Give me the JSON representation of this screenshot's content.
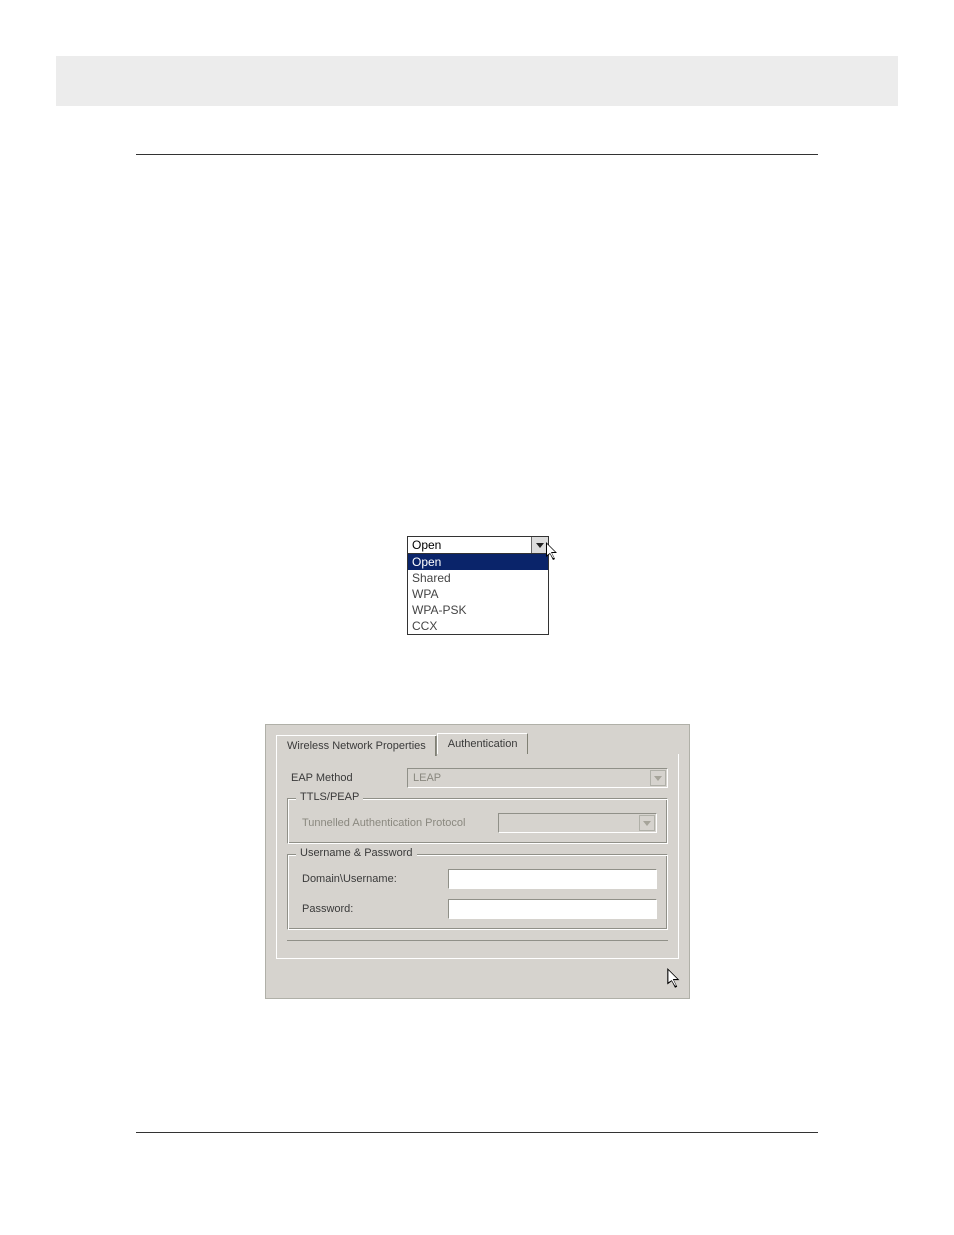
{
  "dropdown": {
    "selected_closed": "Open",
    "options": [
      "Open",
      "Shared",
      "WPA",
      "WPA-PSK",
      "CCX"
    ],
    "highlighted": "Open"
  },
  "dialog": {
    "tabs": {
      "inactive": "Wireless Network Properties",
      "active": "Authentication"
    },
    "eap": {
      "label": "EAP Method",
      "value": "LEAP"
    },
    "ttls_group": {
      "title": "TTLS/PEAP",
      "label": "Tunnelled Authentication Protocol"
    },
    "creds_group": {
      "title": "Username & Password",
      "domain_label": "Domain\\Username:",
      "password_label": "Password:"
    }
  }
}
